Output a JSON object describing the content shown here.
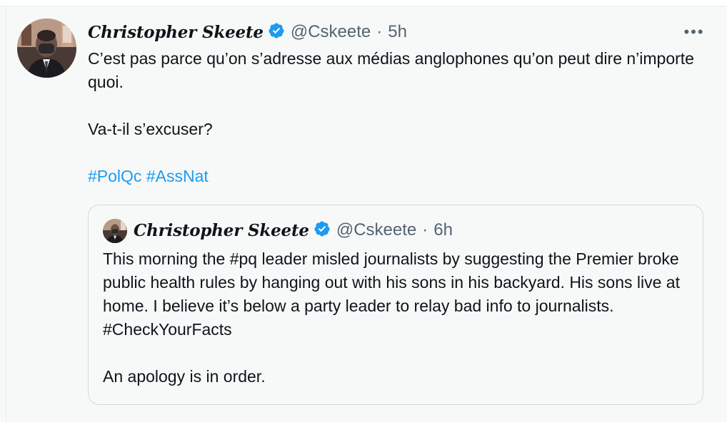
{
  "tweet": {
    "author_name": "Christopher Skeete",
    "handle": "@Cskeete",
    "separator": "·",
    "time": "5h",
    "more_label": "•••",
    "text_line1": "C’est pas parce qu’on s’adresse aux médias anglophones qu’on peut dire n’importe quoi.",
    "text_line2": "Va-t-il s’excuser?",
    "hashtags": [
      "#PolQc",
      "#AssNat"
    ]
  },
  "quoted_tweet": {
    "author_name": "Christopher Skeete",
    "handle": "@Cskeete",
    "separator": "·",
    "time": "6h",
    "text_part1": "This morning the ",
    "hashtag_pq": "#pq",
    "text_part2": " leader misled journalists by suggesting the Premier broke public health rules by hanging out with his sons in his backyard. His sons live at home. I believe it’s below a party leader to relay bad info to journalists. ",
    "hashtag_facts": "#CheckYourFacts",
    "text_line2": "An apology is in order."
  },
  "icons": {
    "verified": "verified-badge-icon",
    "more": "more-options-icon",
    "avatar": "avatar"
  },
  "colors": {
    "text": "#0f1419",
    "muted": "#536471",
    "link": "#1d9bf0",
    "verified": "#1d9bf0",
    "border": "#cfd9de",
    "background": "#f7f9f9"
  }
}
